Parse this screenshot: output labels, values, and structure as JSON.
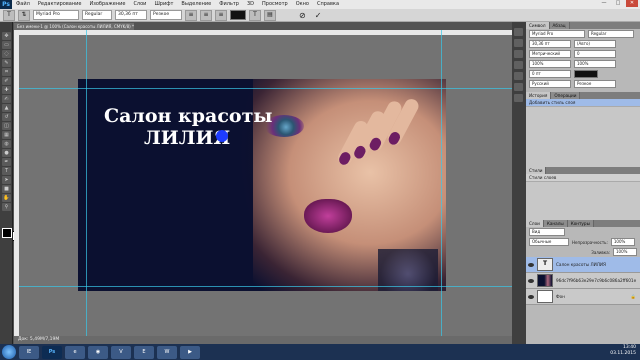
{
  "menubar": {
    "logo": "Ps",
    "items": [
      "Файл",
      "Редактирование",
      "Изображение",
      "Слои",
      "Шрифт",
      "Выделение",
      "Фильтр",
      "3D",
      "Просмотр",
      "Окно",
      "Справка"
    ],
    "minimize": "—",
    "maximize": "□",
    "close": "✕"
  },
  "options": {
    "font_family": "Myriad Pro",
    "font_style": "Regular",
    "font_size": "30,36 пт",
    "antialias": "Резкое",
    "commit": "✓",
    "cancel": "⊘"
  },
  "document": {
    "tab_title": "Без имени-1 @ 100% (Салон красоты ЛИЛИЯ, CMYK/8) *",
    "status": "Док: 5,49M/7,19M",
    "title_line1": "Салон красоты",
    "title_line2": "ЛИЛИЯ"
  },
  "panels": {
    "character": {
      "tabs": [
        "Символ",
        "Абзац"
      ],
      "font_family": "Myriad Pro",
      "font_style": "Regular",
      "size": "30,36 пт",
      "leading": "(Авто)",
      "tracking": "Метрический",
      "kerning": "0",
      "scale_v": "100%",
      "scale_h": "100%",
      "baseline": "0 пт",
      "language": "Русский",
      "aa": "Резкое"
    },
    "history": {
      "tabs": [
        "История",
        "Операции"
      ],
      "items": [
        "Добавить стиль слоя"
      ]
    },
    "layer_styles": {
      "tabs": [
        "Стили"
      ],
      "label": "Стили слоев"
    },
    "layers": {
      "tabs": [
        "Слои",
        "Каналы",
        "Контуры"
      ],
      "search_placeholder": "Вид",
      "blend_mode": "Обычные",
      "opacity_label": "Непрозрачность:",
      "opacity": "100%",
      "fill_label": "Заливка:",
      "fill": "100%",
      "items": [
        {
          "name": "Салон красоты ЛИЛИЯ",
          "type": "text",
          "selected": true
        },
        {
          "name": "96dc7f96b63e29e7c9b6c086a2ff601e",
          "type": "image",
          "selected": false
        },
        {
          "name": "Фон",
          "type": "background",
          "selected": false
        }
      ]
    }
  },
  "taskbar": {
    "apps": [
      "IE",
      "Ps",
      "e",
      "◉",
      "V",
      "E",
      "W",
      "▶"
    ],
    "time": "13:40",
    "date": "03.11.2015"
  },
  "colors": {
    "accent": "#1e3cff",
    "selected_layer": "#9fbbe8",
    "guide": "#39c7e8"
  }
}
